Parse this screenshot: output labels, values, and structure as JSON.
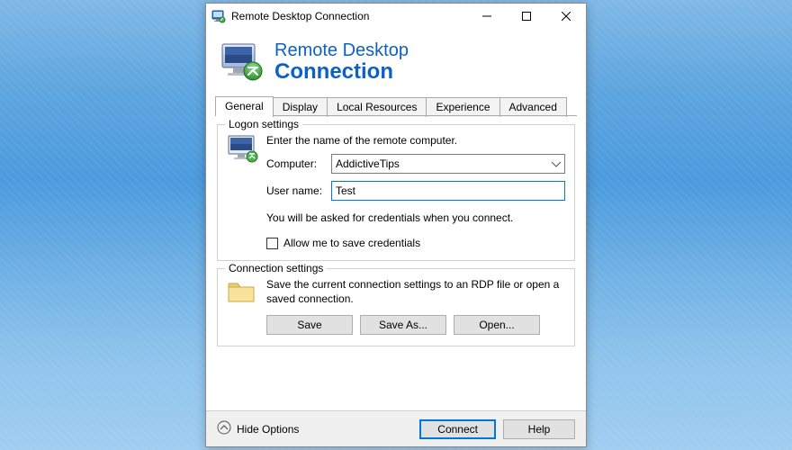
{
  "window": {
    "title": "Remote Desktop Connection"
  },
  "banner": {
    "line1": "Remote Desktop",
    "line2": "Connection"
  },
  "tabs": {
    "general": "General",
    "display": "Display",
    "local_resources": "Local Resources",
    "experience": "Experience",
    "advanced": "Advanced"
  },
  "logon": {
    "legend": "Logon settings",
    "instruction": "Enter the name of the remote computer.",
    "computer_label": "Computer:",
    "computer_value": "AddictiveTips",
    "username_label": "User name:",
    "username_value": "Test",
    "credentials_hint": "You will be asked for credentials when you connect.",
    "save_creds_label": "Allow me to save credentials"
  },
  "connection": {
    "legend": "Connection settings",
    "description": "Save the current connection settings to an RDP file or open a saved connection.",
    "save": "Save",
    "save_as": "Save As...",
    "open": "Open..."
  },
  "footer": {
    "hide_options": "Hide Options",
    "connect": "Connect",
    "help": "Help"
  }
}
